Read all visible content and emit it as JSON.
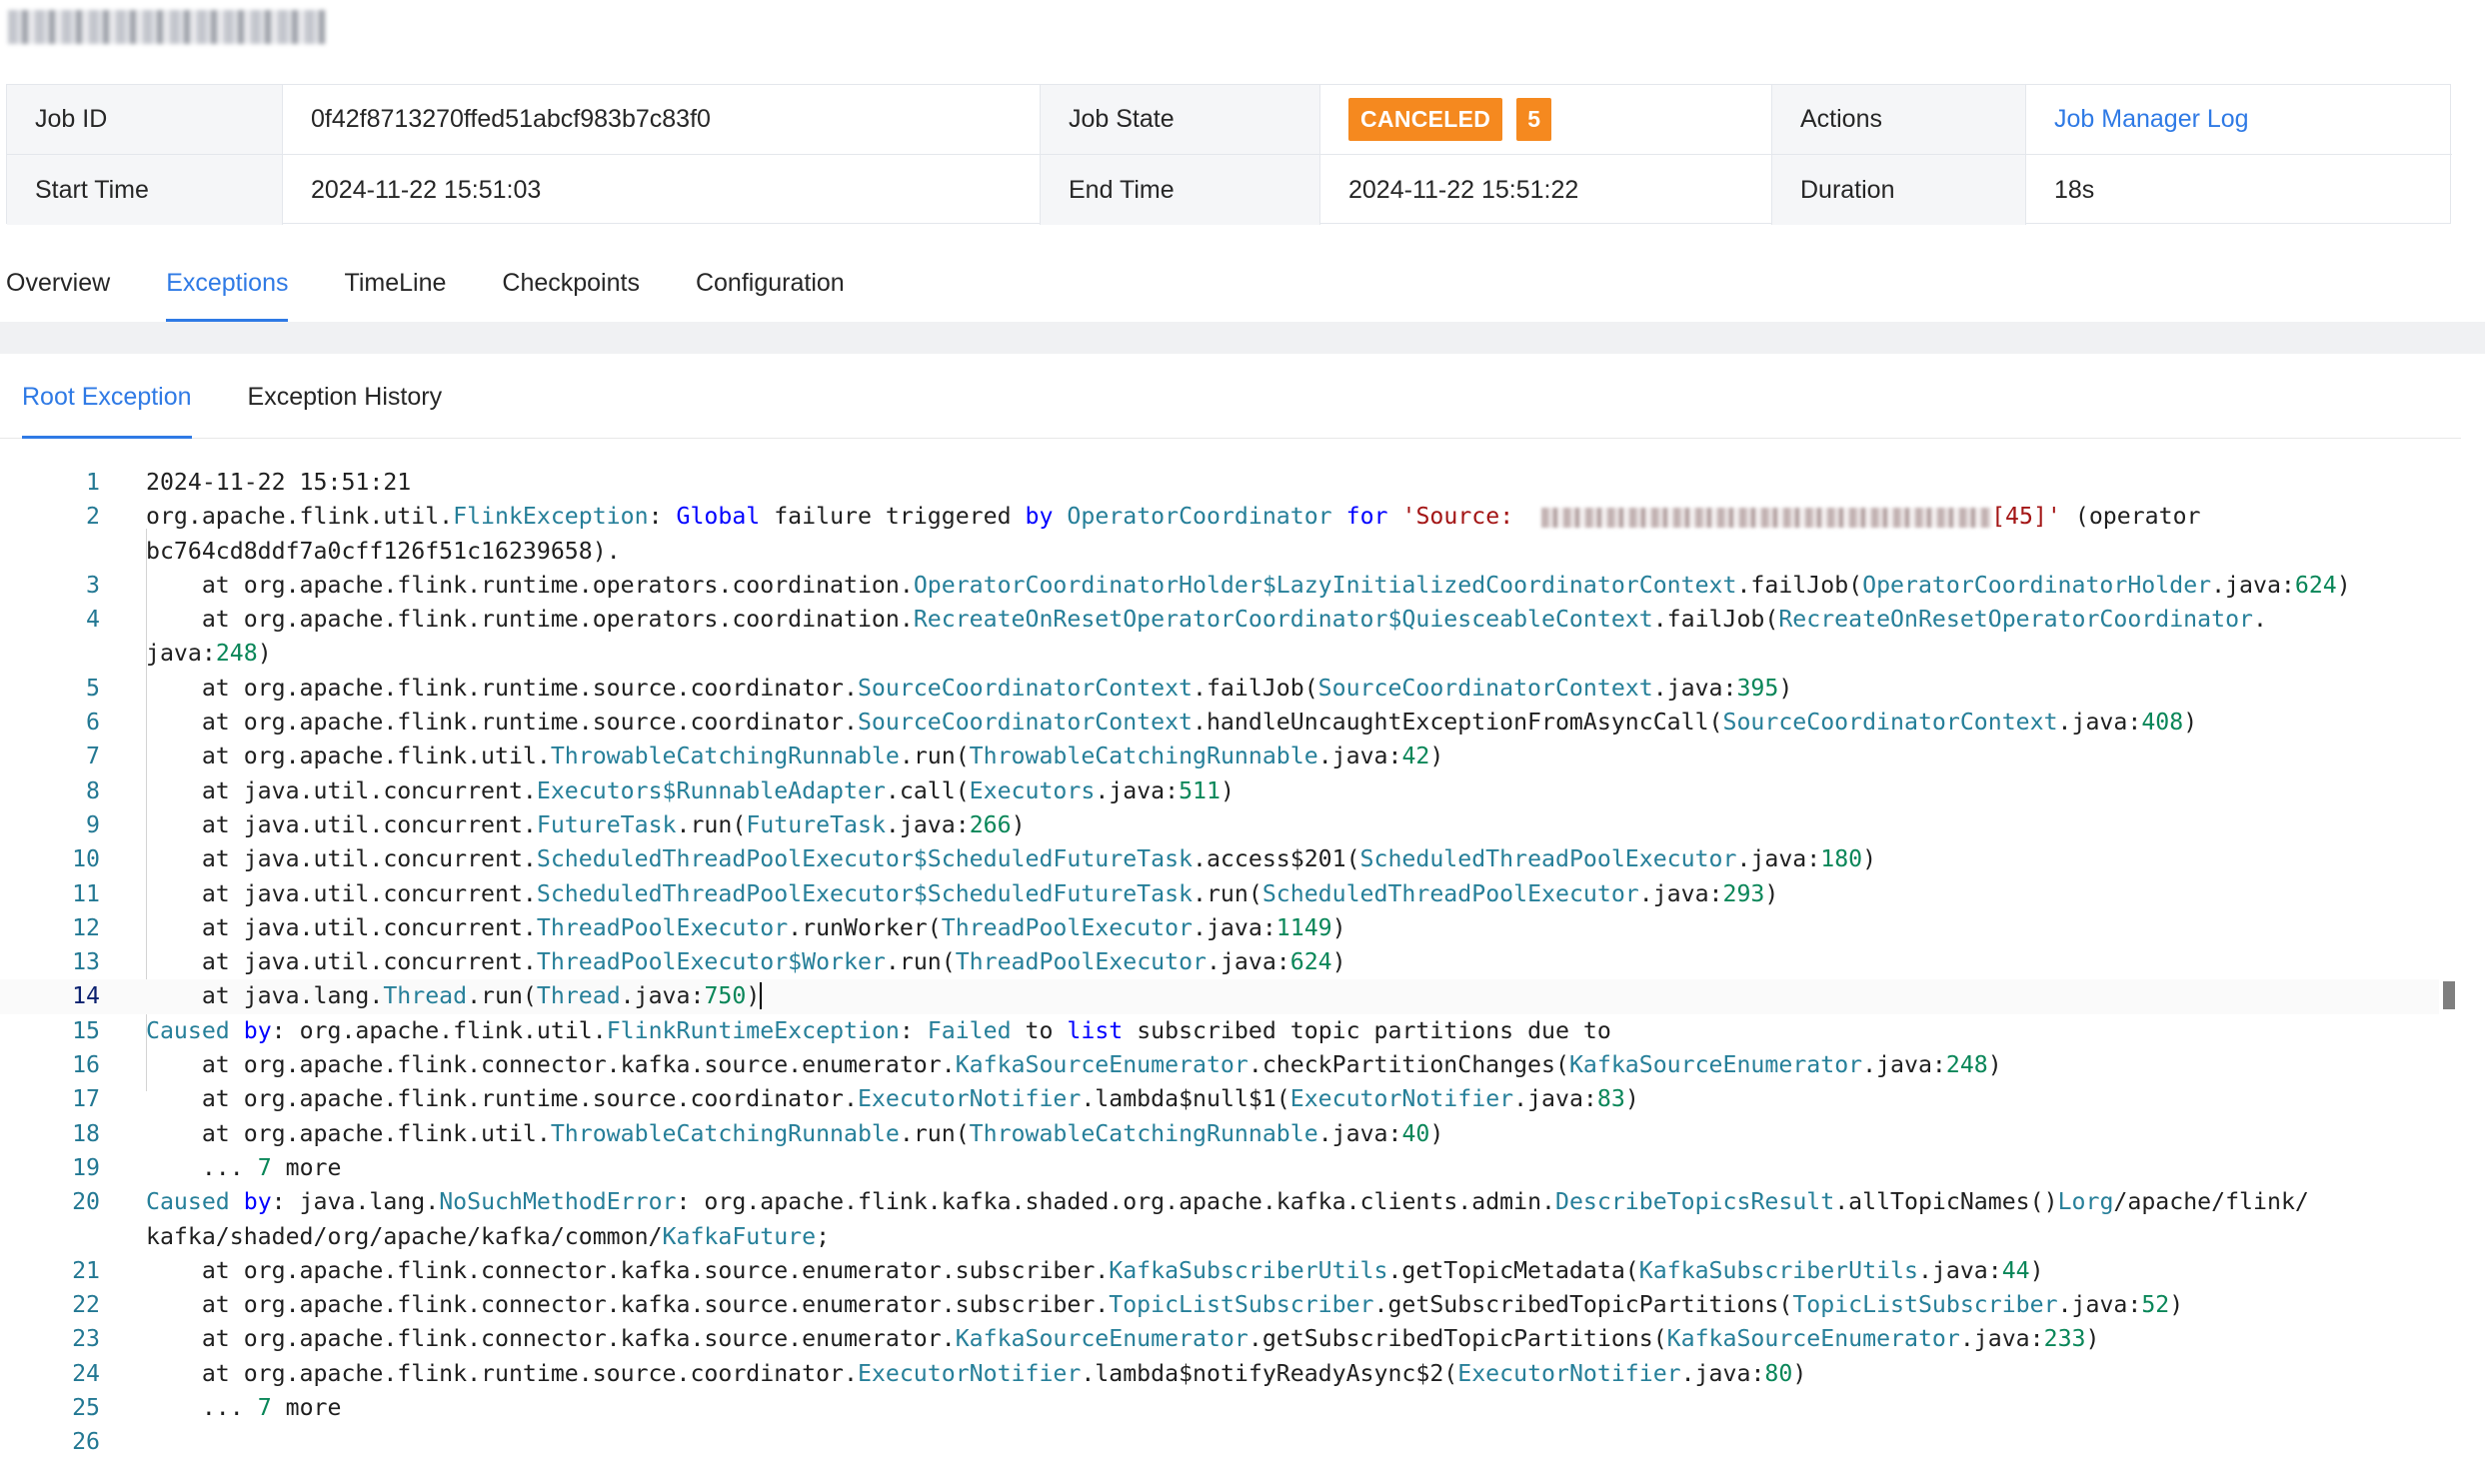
{
  "info": {
    "job_id_label": "Job ID",
    "job_id": "0f42f8713270ffed51abcf983b7c83f0",
    "job_state_label": "Job State",
    "job_state": "CANCELED",
    "job_state_count": "5",
    "actions_label": "Actions",
    "action_link": "Job Manager Log",
    "start_time_label": "Start Time",
    "start_time": "2024-11-22 15:51:03",
    "end_time_label": "End Time",
    "end_time": "2024-11-22 15:51:22",
    "duration_label": "Duration",
    "duration": "18s"
  },
  "tabs": [
    "Overview",
    "Exceptions",
    "TimeLine",
    "Checkpoints",
    "Configuration"
  ],
  "subtabs": [
    "Root Exception",
    "Exception History"
  ],
  "exception": {
    "timestamp": "2024-11-22 15:51:21",
    "source_suffix": "[45]'",
    "operator_id": "bc764cd8ddf7a0cff126f51c16239658"
  }
}
